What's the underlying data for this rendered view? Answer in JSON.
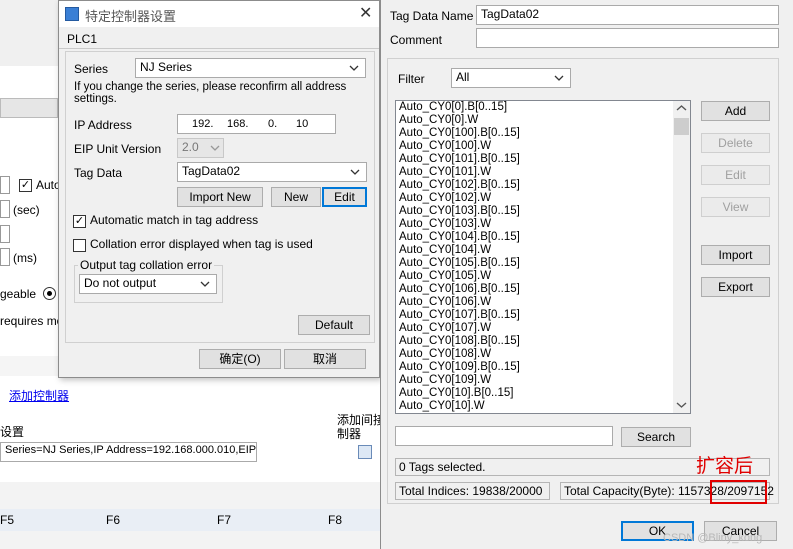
{
  "background_app": {
    "checkbox_label": "Auto",
    "unit_sec": "(sec)",
    "unit_ms": "(ms)",
    "changeable_text": "geable",
    "requires_text": "requires mo",
    "add_controller_link": "添加控制器",
    "settings_label": "设置",
    "add_sub_label": "添加间接",
    "add_sub_label2": "制器",
    "series_line": "Series=NJ Series,IP Address=192.168.000.010,EIP Ur",
    "fkeys": [
      "F5",
      "F6",
      "F7",
      "F8"
    ]
  },
  "dialog1": {
    "title": "特定控制器设置",
    "plc_name": "PLC1",
    "series_label": "Series",
    "series_value": "NJ Series",
    "series_note": "If you change the series, please reconfirm all address settings.",
    "ip_label": "IP Address",
    "ip_octets": [
      "192.",
      "168.",
      "0.",
      "10"
    ],
    "eip_label": "EIP Unit Version",
    "eip_value": "2.0",
    "tagdata_label": "Tag Data",
    "tagdata_value": "TagData02",
    "import_new_label": "Import New",
    "new_label": "New",
    "edit_label": "Edit",
    "auto_match_label": "Automatic match in tag address",
    "auto_match_checked": true,
    "collation_label": "Collation error displayed when tag is used",
    "collation_checked": false,
    "output_group_label": "Output tag collation error",
    "output_value": "Do not output",
    "default_label": "Default",
    "ok_label": "确定(O)",
    "cancel_label": "取消"
  },
  "dialog2": {
    "tag_name_label": "Tag Data Name",
    "tag_name_value": "TagData02",
    "comment_label": "Comment",
    "comment_value": "",
    "filter_label": "Filter",
    "filter_value": "All",
    "tags": [
      "Auto_CY0[0].B[0..15]",
      "Auto_CY0[0].W",
      "Auto_CY0[100].B[0..15]",
      "Auto_CY0[100].W",
      "Auto_CY0[101].B[0..15]",
      "Auto_CY0[101].W",
      "Auto_CY0[102].B[0..15]",
      "Auto_CY0[102].W",
      "Auto_CY0[103].B[0..15]",
      "Auto_CY0[103].W",
      "Auto_CY0[104].B[0..15]",
      "Auto_CY0[104].W",
      "Auto_CY0[105].B[0..15]",
      "Auto_CY0[105].W",
      "Auto_CY0[106].B[0..15]",
      "Auto_CY0[106].W",
      "Auto_CY0[107].B[0..15]",
      "Auto_CY0[107].W",
      "Auto_CY0[108].B[0..15]",
      "Auto_CY0[108].W",
      "Auto_CY0[109].B[0..15]",
      "Auto_CY0[109].W",
      "Auto_CY0[10].B[0..15]",
      "Auto_CY0[10].W"
    ],
    "add_label": "Add",
    "delete_label": "Delete",
    "edit_label": "Edit",
    "view_label": "View",
    "import_label": "Import",
    "export_label": "Export",
    "search_value": "",
    "search_label": "Search",
    "selected_status": "0 Tags selected.",
    "total_indices": "Total Indices: 19838/20000",
    "total_capacity": "Total Capacity(Byte): 1157328/2097152",
    "ok_label": "OK",
    "cancel_label": "Cancel"
  },
  "annotation": {
    "text": "扩容后",
    "color": "#e00000"
  },
  "watermark": "CSDN @Bliny_kong"
}
